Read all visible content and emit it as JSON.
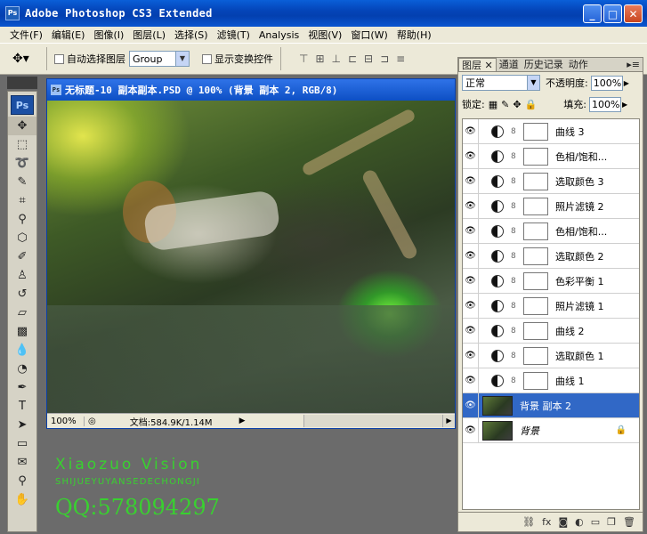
{
  "window": {
    "title": "Adobe Photoshop CS3 Extended",
    "app_icon": "Ps",
    "min": "_",
    "max": "□",
    "close": "✕"
  },
  "menu": [
    "文件(F)",
    "编辑(E)",
    "图像(I)",
    "图层(L)",
    "选择(S)",
    "滤镜(T)",
    "Analysis",
    "视图(V)",
    "窗口(W)",
    "帮助(H)"
  ],
  "options": {
    "auto_select_label": "自动选择图层",
    "auto_select_value": "Group",
    "show_transform_label": "显示变换控件"
  },
  "tools": {
    "logo": "Ps",
    "icons": [
      "move-icon",
      "marquee-icon",
      "lasso-icon",
      "quick-select-icon",
      "crop-icon",
      "eyedropper-icon",
      "healing-icon",
      "brush-icon",
      "stamp-icon",
      "history-brush-icon",
      "eraser-icon",
      "gradient-icon",
      "blur-icon",
      "dodge-icon",
      "pen-icon",
      "type-icon",
      "path-select-icon",
      "shape-icon",
      "notes-icon",
      "eyedropper2-icon",
      "hand-icon"
    ]
  },
  "document": {
    "title": "无标题-10 副本副本.PSD @ 100% (背景 副本 2, RGB/8)",
    "zoom": "100%",
    "doc_info": "文档:584.9K/1.14M"
  },
  "watermark": {
    "line1": "Xiaozuo Vision",
    "line2": "SHIJUEYUYANSEDECHONGJI",
    "line3": "QQ:578094297"
  },
  "layers_panel": {
    "tabs": [
      "图层",
      "通道",
      "历史记录",
      "动作"
    ],
    "blend_mode": "正常",
    "opacity_label": "不透明度:",
    "opacity": "100%",
    "lock_label": "锁定:",
    "fill_label": "填充:",
    "fill": "100%",
    "layers": [
      {
        "name": "曲线 3",
        "type": "adjustment"
      },
      {
        "name": "色相/饱和...",
        "type": "adjustment"
      },
      {
        "name": "选取颜色 3",
        "type": "adjustment"
      },
      {
        "name": "照片滤镜 2",
        "type": "adjustment"
      },
      {
        "name": "色相/饱和...",
        "type": "adjustment"
      },
      {
        "name": "选取颜色 2",
        "type": "adjustment"
      },
      {
        "name": "色彩平衡 1",
        "type": "adjustment"
      },
      {
        "name": "照片滤镜 1",
        "type": "adjustment"
      },
      {
        "name": "曲线 2",
        "type": "adjustment"
      },
      {
        "name": "选取颜色 1",
        "type": "adjustment"
      },
      {
        "name": "曲线 1",
        "type": "adjustment"
      },
      {
        "name": "背景 副本 2",
        "type": "image",
        "selected": true
      },
      {
        "name": "背景",
        "type": "image",
        "locked": true
      }
    ]
  }
}
